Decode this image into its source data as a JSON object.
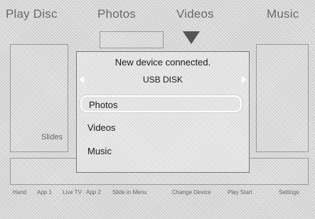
{
  "background_menu": {
    "tabs": [
      "Play Disc",
      "Photos",
      "Videos",
      "Music"
    ],
    "side_label": "Slides",
    "bottom_bar": [
      "Hand",
      "App 1",
      "Live TV",
      "App 2",
      "Slide in Menu",
      "Change Device",
      "Play Start",
      "Settings"
    ]
  },
  "dialog": {
    "title": "New device connected.",
    "device_name": "USB DISK",
    "options": [
      "Photos",
      "Videos",
      "Music"
    ],
    "selected_option": "Photos"
  }
}
